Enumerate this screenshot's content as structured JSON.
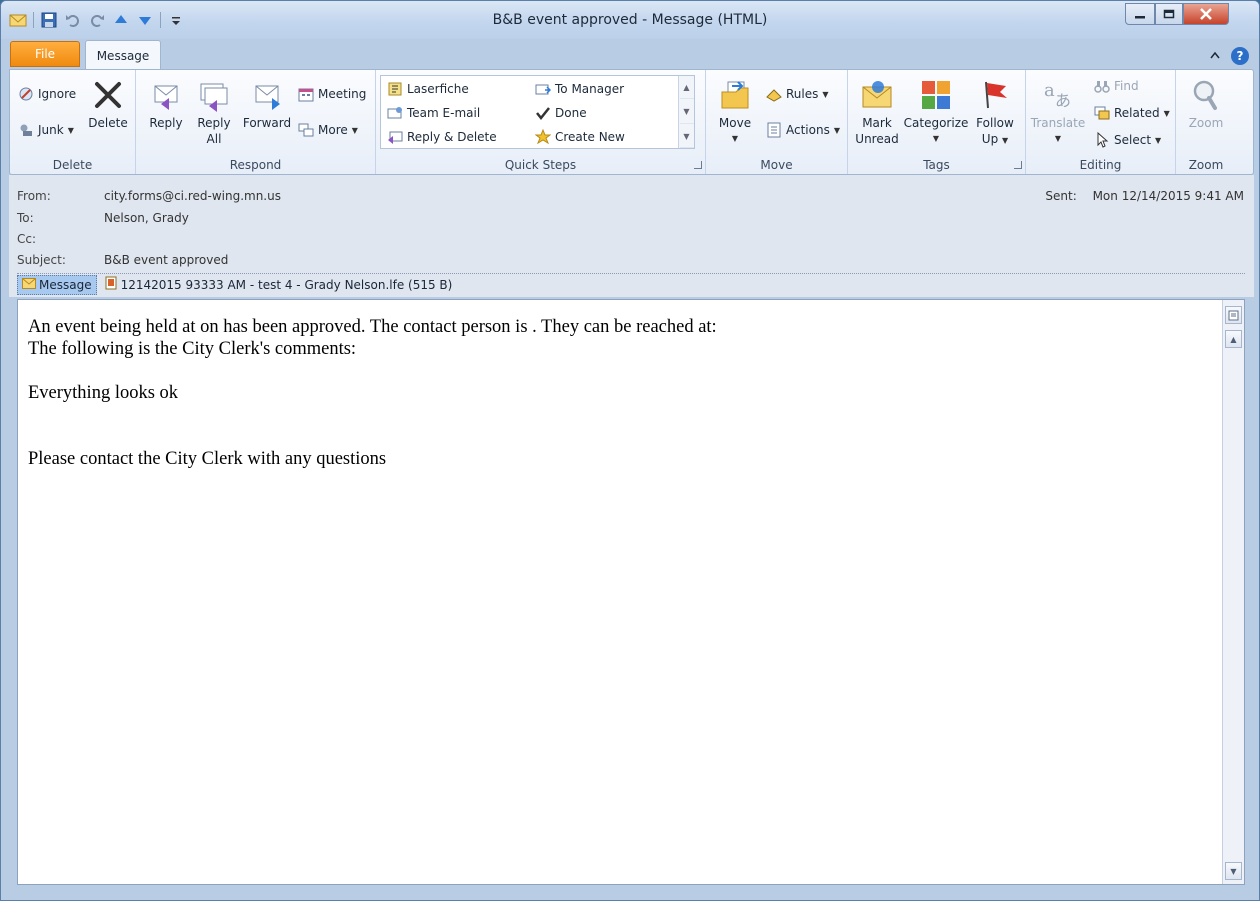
{
  "window": {
    "title": "B&B event approved",
    "title_sep": "-",
    "title_suffix": "Message (HTML)"
  },
  "tabs": {
    "file": "File",
    "message": "Message"
  },
  "ribbon": {
    "delete_group": {
      "label": "Delete",
      "ignore": "Ignore",
      "junk": "Junk",
      "delete": "Delete"
    },
    "respond_group": {
      "label": "Respond",
      "reply": "Reply",
      "reply_all_1": "Reply",
      "reply_all_2": "All",
      "forward": "Forward",
      "meeting": "Meeting",
      "more": "More"
    },
    "quick_steps": {
      "label": "Quick Steps",
      "items": [
        "Laserfiche",
        "To Manager",
        "Team E-mail",
        "Done",
        "Reply & Delete",
        "Create New"
      ]
    },
    "move_group": {
      "label": "Move",
      "move": "Move",
      "rules": "Rules",
      "actions": "Actions"
    },
    "tags_group": {
      "label": "Tags",
      "mark_unread_1": "Mark",
      "mark_unread_2": "Unread",
      "categorize": "Categorize",
      "follow_up_1": "Follow",
      "follow_up_2": "Up"
    },
    "editing_group": {
      "label": "Editing",
      "translate": "Translate",
      "find": "Find",
      "related": "Related",
      "select": "Select"
    },
    "zoom_group": {
      "label": "Zoom",
      "zoom": "Zoom"
    }
  },
  "header": {
    "from_label": "From:",
    "from_value": "city.forms@ci.red-wing.mn.us",
    "to_label": "To:",
    "to_value": "Nelson, Grady",
    "cc_label": "Cc:",
    "cc_value": "",
    "subject_label": "Subject:",
    "subject_value": "B&B event approved",
    "sent_label": "Sent:",
    "sent_value": "Mon 12/14/2015 9:41 AM"
  },
  "attachments": {
    "message_tab": "Message",
    "file": "12142015 93333 AM - test 4 - Grady Nelson.lfe (515 B)"
  },
  "body": {
    "line1": "An event being held at on has been approved. The contact person is . They can be reached at:",
    "line2": "The following is the City Clerk's comments:",
    "line3": "Everything looks ok",
    "line4": "Please contact the City Clerk with any questions"
  },
  "colors": {
    "file_tab": "#f08a0f",
    "chrome": "#b8cce4",
    "attachment_highlight": "#a8c9ef"
  }
}
